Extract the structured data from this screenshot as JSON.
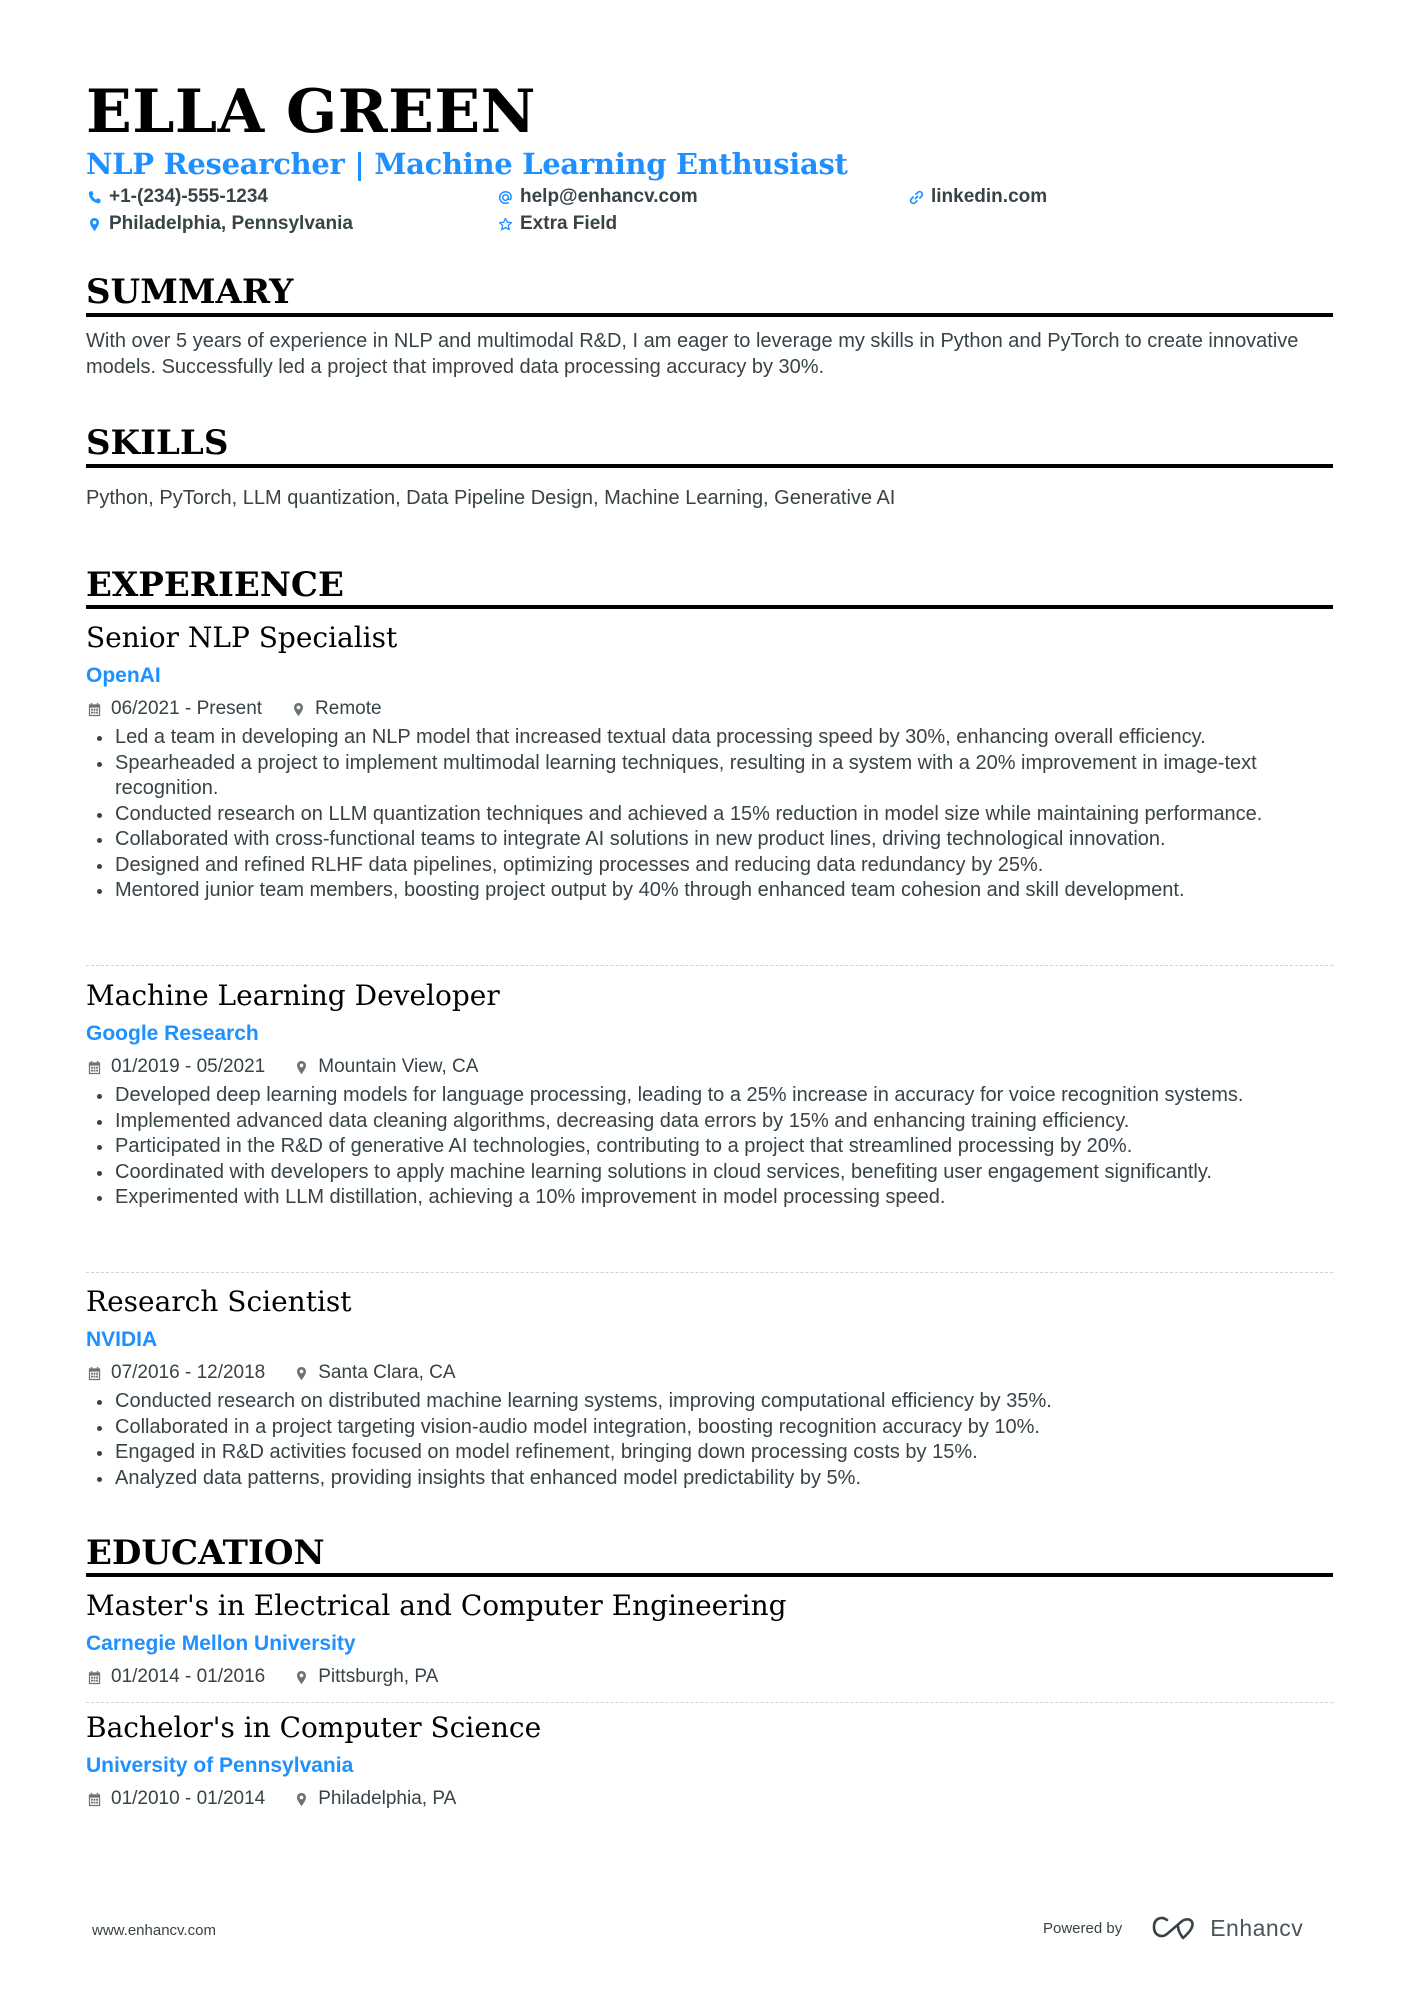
{
  "header": {
    "name": "ELLA GREEN",
    "headline": "NLP Researcher | Machine Learning Enthusiast",
    "contacts": [
      {
        "icon": "phone-icon",
        "value": "+1-(234)-555-1234"
      },
      {
        "icon": "at-icon",
        "value": "help@enhancv.com"
      },
      {
        "icon": "link-icon",
        "value": "linkedin.com"
      },
      {
        "icon": "location-pin-icon",
        "value": "Philadelphia, Pennsylvania"
      },
      {
        "icon": "star-icon",
        "value": "Extra Field"
      }
    ]
  },
  "summary": {
    "title": "SUMMARY",
    "text": "With over 5 years of experience in NLP and multimodal R&D, I am eager to leverage my skills in Python and PyTorch to create innovative models. Successfully led a project that improved data processing accuracy by 30%."
  },
  "skills": {
    "title": "SKILLS",
    "text": "Python, PyTorch, LLM quantization, Data Pipeline Design, Machine Learning, Generative AI"
  },
  "experience": {
    "title": "EXPERIENCE",
    "jobs": [
      {
        "title": "Senior NLP Specialist",
        "company": "OpenAI",
        "dates": "06/2021 - Present",
        "location": "Remote",
        "bullets": [
          "Led a team in developing an NLP model that increased textual data processing speed by 30%, enhancing overall efficiency.",
          "Spearheaded a project to implement multimodal learning techniques, resulting in a system with a 20% improvement in image-text recognition.",
          "Conducted research on LLM quantization techniques and achieved a 15% reduction in model size while maintaining performance.",
          "Collaborated with cross-functional teams to integrate AI solutions in new product lines, driving technological innovation.",
          "Designed and refined RLHF data pipelines, optimizing processes and reducing data redundancy by 25%.",
          "Mentored junior team members, boosting project output by 40% through enhanced team cohesion and skill development."
        ]
      },
      {
        "title": "Machine Learning Developer",
        "company": "Google Research",
        "dates": "01/2019 - 05/2021",
        "location": "Mountain View, CA",
        "bullets": [
          "Developed deep learning models for language processing, leading to a 25% increase in accuracy for voice recognition systems.",
          "Implemented advanced data cleaning algorithms, decreasing data errors by 15% and enhancing training efficiency.",
          "Participated in the R&D of generative AI technologies, contributing to a project that streamlined processing by 20%.",
          "Coordinated with developers to apply machine learning solutions in cloud services, benefiting user engagement significantly.",
          "Experimented with LLM distillation, achieving a 10% improvement in model processing speed."
        ]
      },
      {
        "title": "Research Scientist",
        "company": "NVIDIA",
        "dates": "07/2016 - 12/2018",
        "location": "Santa Clara, CA",
        "bullets": [
          "Conducted research on distributed machine learning systems, improving computational efficiency by 35%.",
          "Collaborated in a project targeting vision-audio model integration, boosting recognition accuracy by 10%.",
          "Engaged in R&D activities focused on model refinement, bringing down processing costs by 15%.",
          "Analyzed data patterns, providing insights that enhanced model predictability by 5%."
        ]
      }
    ]
  },
  "education": {
    "title": "EDUCATION",
    "items": [
      {
        "degree": "Master's in Electrical and Computer Engineering",
        "school": "Carnegie Mellon University",
        "dates": "01/2014 - 01/2016",
        "location": "Pittsburgh, PA"
      },
      {
        "degree": "Bachelor's in Computer Science",
        "school": "University of Pennsylvania",
        "dates": "01/2010 - 01/2014",
        "location": "Philadelphia, PA"
      }
    ]
  },
  "footer": {
    "website": "www.enhancv.com",
    "powered_by": "Powered by",
    "brand": "Enhancv"
  },
  "colors": {
    "accent": "#1e90ff",
    "text": "#384347",
    "heading": "#000000"
  }
}
